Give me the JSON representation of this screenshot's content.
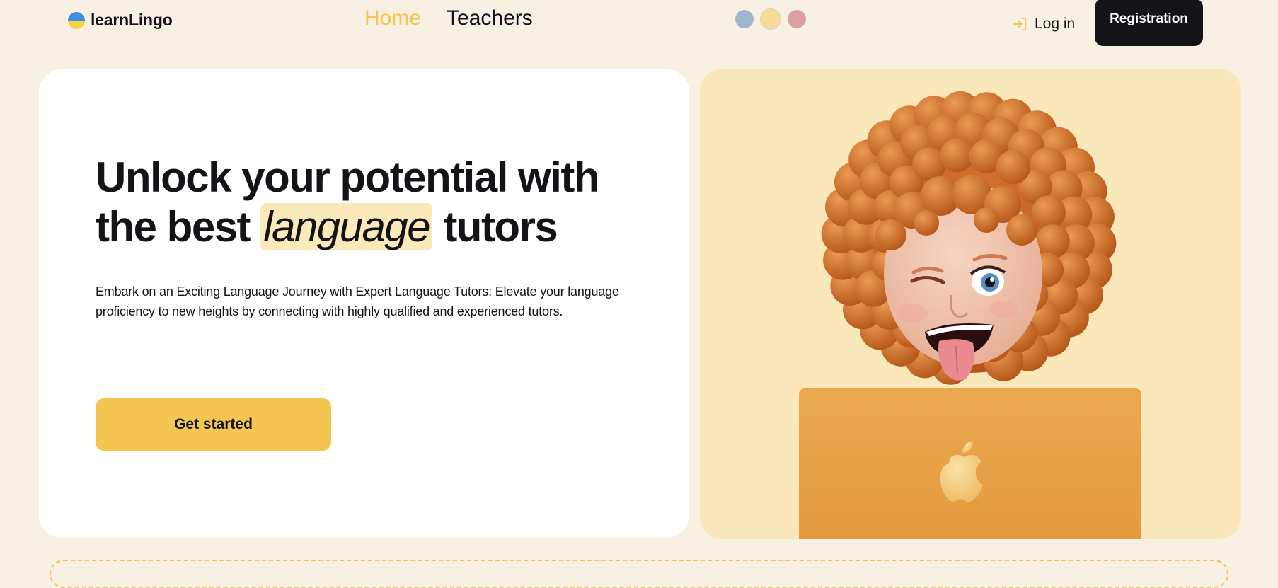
{
  "header": {
    "logo_text": "learnLingo",
    "logo_icon": "ukraine-flag-icon",
    "nav": [
      {
        "label": "Home",
        "active": true
      },
      {
        "label": "Teachers",
        "active": false
      }
    ],
    "theme_colors": [
      "#9fb7ce",
      "#f4dd9a",
      "#e09f9f"
    ],
    "selected_theme": 1,
    "login_icon": "log-in-icon",
    "login_label": "Log in",
    "register_label": "Registration"
  },
  "hero": {
    "title_part1": "Unlock your potential with the best",
    "title_highlight": "language",
    "title_part2": "tutors",
    "description": "Embark on an Exciting Language Journey with Expert Language Tutors: Elevate your language proficiency to new heights by connecting with highly qualified and experienced tutors.",
    "cta_label": "Get started"
  },
  "illustration": {
    "image": "memoji-girl-with-laptop",
    "laptop_icon": "apple-logo-icon"
  },
  "colors": {
    "accent": "#f4c550",
    "accent_light": "#fbe9ba",
    "dark": "#121417",
    "background": "#f8f0e2"
  }
}
